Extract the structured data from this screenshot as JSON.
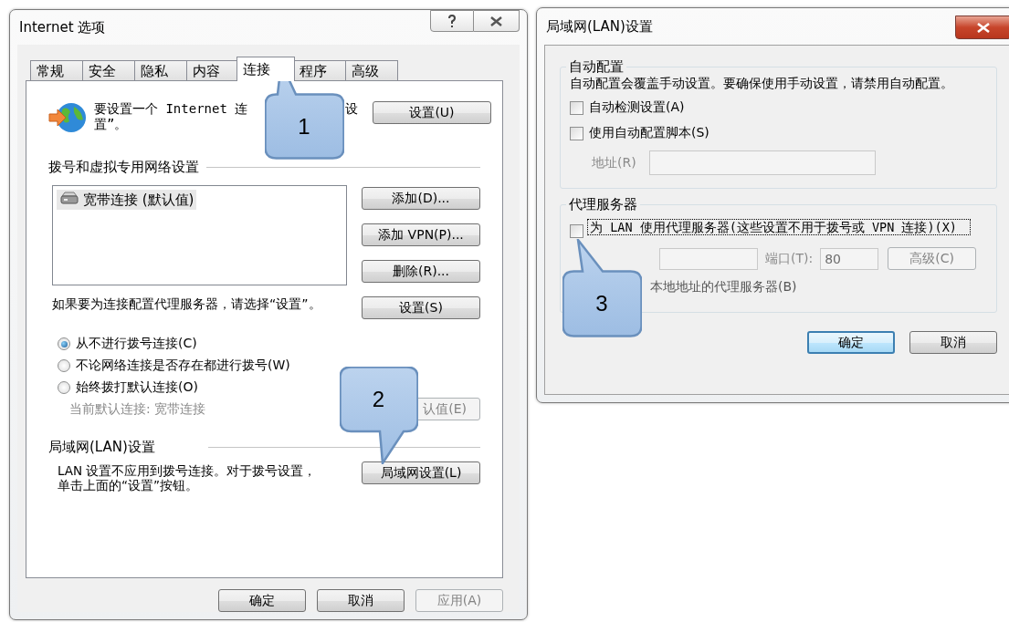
{
  "internet_options": {
    "title": "Internet 选项",
    "tabs": [
      {
        "label": "常规",
        "selected": false
      },
      {
        "label": "安全",
        "selected": false
      },
      {
        "label": "隐私",
        "selected": false
      },
      {
        "label": "内容",
        "selected": false
      },
      {
        "label": "连接",
        "selected": true
      },
      {
        "label": "程序",
        "selected": false
      },
      {
        "label": "高级",
        "selected": false
      }
    ],
    "setup": {
      "text_parts": [
        "要设置一个 Internet 连",
        "设",
        "置”。"
      ],
      "button": "设置(U)"
    },
    "dialup": {
      "heading": "拨号和虚拟专用网络设置",
      "connections": [
        {
          "label": "宽带连接 (默认值)",
          "selected": true
        }
      ],
      "buttons": [
        "添加(D)...",
        "添加 VPN(P)...",
        "删除(R)..."
      ]
    },
    "proxy_hint": {
      "text": "如果要为连接配置代理服务器，请选择“设置”。",
      "button": "设置(S)"
    },
    "dial_options": [
      {
        "label": "从不进行拨号连接(C)",
        "selected": true
      },
      {
        "label": "不论网络连接是否存在都进行拨号(W)",
        "selected": false
      },
      {
        "label": "始终拨打默认连接(O)",
        "selected": false
      }
    ],
    "default_connection": {
      "text": "当前默认连接: 宽带连接",
      "disabled": true
    },
    "default_button": {
      "label": "认值(E)",
      "disabled": true
    },
    "lan": {
      "heading": "局域网(LAN)设置",
      "text": "LAN 设置不应用到拨号连接。对于拨号设置，单击上面的“设置”按钮。",
      "button": "局域网设置(L)"
    },
    "buttons": [
      {
        "label": "确定",
        "disabled": false
      },
      {
        "label": "取消",
        "disabled": false
      },
      {
        "label": "应用(A)",
        "disabled": true
      }
    ]
  },
  "lan_settings": {
    "title": "局域网(LAN)设置",
    "auto_config": {
      "heading": "自动配置",
      "text": "自动配置会覆盖手动设置。要确保使用手动设置，请禁用自动配置。",
      "options": [
        {
          "label": "自动检测设置(A)",
          "checked": false
        },
        {
          "label": "使用自动配置脚本(S)",
          "checked": false
        }
      ],
      "address": {
        "label": "地址(R)",
        "disabled": true
      }
    },
    "proxy": {
      "heading": "代理服务器",
      "use_proxy": {
        "label": "为 LAN 使用代理服务器(这些设置不用于拨号或 VPN 连接)(X)",
        "checked": false,
        "focused": true
      },
      "address_disabled": true,
      "port_label": "端口(T):",
      "port": "80",
      "advanced": {
        "label": "高级(C)",
        "disabled": true
      },
      "bypass_text": "本地地址的代理服务器(B)"
    },
    "buttons": [
      {
        "label": "确定",
        "default": true
      },
      {
        "label": "取消",
        "default": false
      }
    ]
  },
  "callouts": [
    {
      "label": "1"
    },
    {
      "label": "2"
    },
    {
      "label": "3"
    }
  ]
}
